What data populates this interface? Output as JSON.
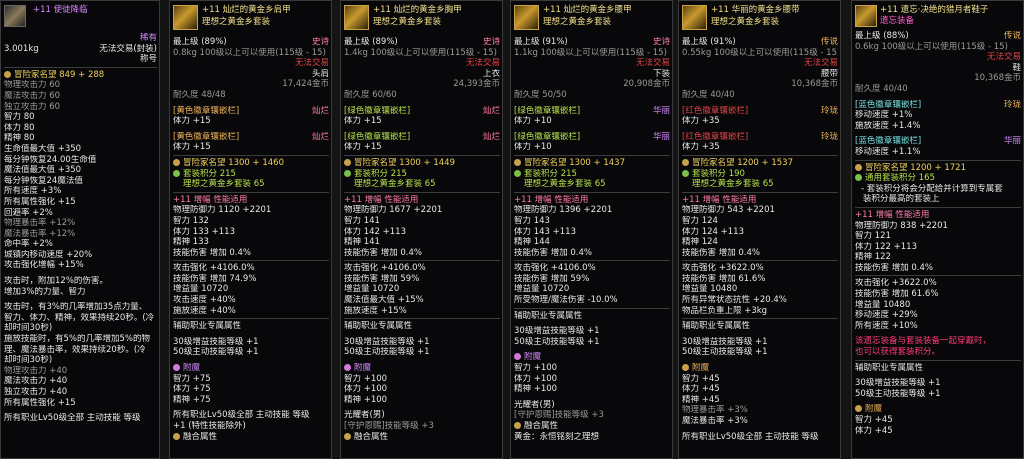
{
  "p1": {
    "name": "+11 使徒降临",
    "rows": [
      [
        "",
        "稀有"
      ],
      [
        "3.001kg",
        "无法交易(封装)"
      ],
      [
        "",
        "称号"
      ]
    ],
    "lines": [
      "冒险家名望 849 + 288",
      "物理攻击力 60",
      "魔法攻击力 60",
      "独立攻击力 60",
      "智力 80",
      "体力 80",
      "精神 80",
      "生命值最大值 +350",
      "每分钟恢复24.00生命值",
      "魔法值最大值 +350",
      "每分钟恢复24魔法值",
      "所有速度 +3%",
      "所有属性强化 +15",
      "回避率 +2%",
      "物理暴击率 +12%",
      "魔法暴击率 +12%",
      "命中率 +2%",
      "城镇内移动速度 +20%",
      "攻击强化增幅 +15%",
      "攻击时，附加12%的伤害。",
      "增加3%的力量、智力",
      "攻击时，有3%的几率增加35点力量、",
      "智力、体力、精神，效果持续20秒。(冷",
      "却时间30秒)",
      "施放技能时，有5%的几率增加5%的物",
      "理、魔法暴击率，效果持续20秒。(冷",
      "却时间30秒)",
      "物理攻击力 +40",
      "魔法攻击力 +40",
      "独立攻击力 +40",
      "所有属性强化 +15",
      "所有职业Lv50级全部 主动技能 等级"
    ]
  },
  "p2": {
    "name": "+11 灿烂的黄金乡肩甲",
    "setname": "理想之黄金乡套装",
    "rows": [
      [
        "最上级 (89%)",
        "史诗"
      ],
      [
        "0.8kg 100级以上可以使用(115级 - 15)",
        ""
      ],
      [
        "",
        "无法交易"
      ],
      [
        "",
        "头肩"
      ],
      [
        "",
        "17,424金币"
      ],
      [
        "耐久度 48/48",
        ""
      ]
    ],
    "slots": [
      {
        "name": "[黄色徽章镶嵌栏]",
        "grade": "灿烂",
        "stat": "体力 +15"
      },
      {
        "name": "[黄色徽章镶嵌栏]",
        "grade": "灿烂",
        "stat": "体力 +15"
      }
    ],
    "lines": [
      "冒险家名望 1300 + 1460",
      "套装积分 215",
      "理想之黄金乡套装 65",
      "+11 增幅 性能适用",
      "物理防御力 1120 +2201",
      "智力 132",
      "体力 133 +113",
      "精神 133",
      "技能伤害 增加 0.4%",
      "攻击强化 +4106.0%",
      "技能伤害 增加 74.9%",
      "增益量 10720",
      "攻击速度 +40%",
      "施放速度 +40%",
      "辅助职业专属属性",
      "30级增益技能等级 +1",
      "50级主动技能等级 +1",
      "附魔",
      "智力 +75",
      "体力 +75",
      "精神 +75",
      "所有职业Lv50级全部 主动技能 等级",
      "+1 (特性技能除外)",
      "融合属性"
    ]
  },
  "p3": {
    "name": "+11 灿烂的黄金乡胸甲",
    "setname": "理想之黄金乡套装",
    "rows": [
      [
        "最上级 (89%)",
        "史诗"
      ],
      [
        "1.4kg 100级以上可以使用(115级 - 15)",
        ""
      ],
      [
        "",
        "无法交易"
      ],
      [
        "",
        "上衣"
      ],
      [
        "",
        "24,393金币"
      ],
      [
        "耐久度 60/60",
        ""
      ]
    ],
    "slots": [
      {
        "name": "[绿色徽章镶嵌栏]",
        "grade": "灿烂",
        "stat": "体力 +15"
      },
      {
        "name": "[绿色徽章镶嵌栏]",
        "grade": "灿烂",
        "stat": "体力 +15"
      }
    ],
    "lines": [
      "冒险家名望 1300 + 1449",
      "套装积分 215",
      "理想之黄金乡套装 65",
      "+11 增幅 性能适用",
      "物理防御力 1677 +2201",
      "智力 141",
      "体力 142 +113",
      "精神 141",
      "技能伤害 增加 0.4%",
      "攻击强化 +4106.0%",
      "技能伤害 增加 59%",
      "增益量 10720",
      "魔法值最大值 +15%",
      "施放速度 +15%",
      "辅助职业专属属性",
      "30级增益技能等级 +1",
      "50级主动技能等级 +1",
      "附魔",
      "智力 +100",
      "体力 +100",
      "精神 +100",
      "光耀者(男)",
      "[守护恩赐]技能等级 +3",
      "融合属性"
    ]
  },
  "p4": {
    "name": "+11 灿烂的黄金乡腰甲",
    "setname": "理想之黄金乡套装",
    "rows": [
      [
        "最上级 (91%)",
        "史诗"
      ],
      [
        "1.1kg 100级以上可以使用(115级 - 15)",
        ""
      ],
      [
        "",
        "无法交易"
      ],
      [
        "",
        "下装"
      ],
      [
        "",
        "20,908金币"
      ],
      [
        "耐久度 50/50",
        ""
      ]
    ],
    "slots": [
      {
        "name": "[绿色徽章镶嵌栏]",
        "grade": "华丽",
        "stat": "体力 +10"
      },
      {
        "name": "[绿色徽章镶嵌栏]",
        "grade": "华丽",
        "stat": "体力 +10"
      }
    ],
    "lines": [
      "冒险家名望 1300 + 1437",
      "套装积分 215",
      "理想之黄金乡套装 65",
      "+11 增幅 性能适用",
      "物理防御力 1396 +2201",
      "智力 143",
      "体力 143 +113",
      "精神 144",
      "技能伤害 增加 0.4%",
      "攻击强化 +4106.0%",
      "技能伤害 增加 59%",
      "增益量 10720",
      "所受物理/魔法伤害 -10.0%",
      "辅助职业专属属性",
      "30级增益技能等级 +1",
      "50级主动技能等级 +1",
      "附魔",
      "智力 +100",
      "体力 +100",
      "精神 +100",
      "光耀者(男)",
      "[守护恩赐]技能等级 +3",
      "融合属性",
      "黄金：永恒铭刻之理想"
    ]
  },
  "p5": {
    "name": "+11 华丽的黄金乡腰带",
    "setname": "理想之黄金乡套装",
    "rows": [
      [
        "最上级 (91%)",
        "传说"
      ],
      [
        "0.55kg 100级以上可以使用(115级 - 15)",
        ""
      ],
      [
        "",
        "无法交易"
      ],
      [
        "",
        "腰带"
      ],
      [
        "",
        "10,368金币"
      ],
      [
        "耐久度 40/40",
        ""
      ]
    ],
    "slots": [
      {
        "name": "[红色徽章镶嵌栏]",
        "grade": "玲珑",
        "stat": "体力 +35"
      },
      {
        "name": "[红色徽章镶嵌栏]",
        "grade": "玲珑",
        "stat": "体力 +35"
      }
    ],
    "lines": [
      "冒险家名望 1200 + 1537",
      "套装积分 190",
      "理想之黄金乡套装 65",
      "+11 增幅 性能适用",
      "物理防御力 543 +2201",
      "智力 124",
      "体力 124 +113",
      "精神 124",
      "技能伤害 增加 0.4%",
      "攻击强化 +3622.0%",
      "技能伤害 增加 61.6%",
      "增益量 10480",
      "所有异常状态抗性 +20.4%",
      "物品栏负重上限 +3kg",
      "辅助职业专属属性",
      "30级增益技能等级 +1",
      "50级主动技能等级 +1",
      "附魔",
      "智力 +45",
      "体力 +45",
      "精神 +45",
      "物理暴击率 +3%",
      "魔法暴击率 +3%",
      "所有职业Lv50级全部 主动技能 等级"
    ]
  },
  "p6": {
    "name": "+11 遗忘·决绝的猎月者鞋子",
    "setname": "遗忘装备",
    "rows": [
      [
        "最上级 (88%)",
        "传说"
      ],
      [
        "0.6kg 100级以上可以使用(115级 - 15)",
        ""
      ],
      [
        "",
        "无法交易"
      ],
      [
        "",
        "鞋"
      ],
      [
        "",
        "10,368金币"
      ],
      [
        "耐久度 40/40",
        ""
      ]
    ],
    "slots": [
      {
        "name": "[蓝色徽章镶嵌栏]",
        "grade": "玲珑",
        "stat": "移动速度 +1%",
        "stat2": "施放速度 +1.4%"
      },
      {
        "name": "[蓝色徽章镶嵌栏]",
        "grade": "华丽",
        "stat": "移动速度 +1.1%"
      }
    ],
    "lines": [
      "冒险家名望 1200 + 1721",
      "通用套装积分 165",
      "套装积分将会分配给并计算到专属套",
      "装积分最高的套装上",
      "+11 增幅 性能适用",
      "物理防御力 838 +2201",
      "智力 121",
      "体力 122 +113",
      "精神 122",
      "技能伤害 增加 0.4%",
      "攻击强化 +3622.0%",
      "技能伤害 增加 61.6%",
      "增益量 10480",
      "移动速度 +29%",
      "所有速度 +10%",
      "该遗忘装备与套装装备一起穿戴时，",
      "也可以获得套装积分。",
      "辅助职业专属属性",
      "30级增益技能等级 +1",
      "50级主动技能等级 +1",
      "附魔",
      "智力 +45",
      "体力 +45"
    ]
  }
}
